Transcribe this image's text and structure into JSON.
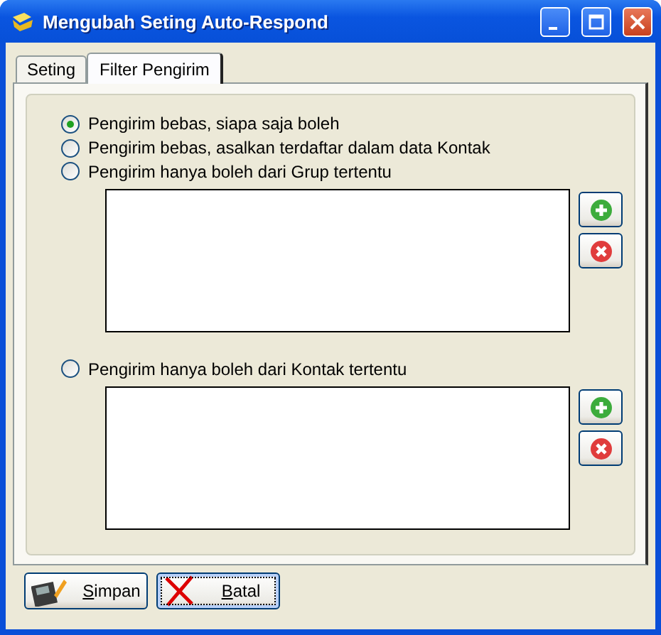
{
  "window": {
    "title": "Mengubah Seting Auto-Respond"
  },
  "tabs": [
    {
      "label": "Seting",
      "selected": false
    },
    {
      "label": "Filter Pengirim",
      "selected": true
    }
  ],
  "options": [
    {
      "label": "Pengirim bebas, siapa saja boleh",
      "selected": true,
      "kind": "plain"
    },
    {
      "label": "Pengirim bebas, asalkan terdaftar dalam data Kontak",
      "selected": false,
      "kind": "plain"
    },
    {
      "label": "Pengirim hanya boleh dari Grup tertentu",
      "selected": false,
      "kind": "list"
    },
    {
      "label": "Pengirim hanya boleh dari Kontak tertentu",
      "selected": false,
      "kind": "list"
    }
  ],
  "buttons": [
    {
      "label": "Simpan",
      "kind": "save",
      "focused": false
    },
    {
      "label": "Batal",
      "kind": "cancel",
      "focused": true
    }
  ]
}
